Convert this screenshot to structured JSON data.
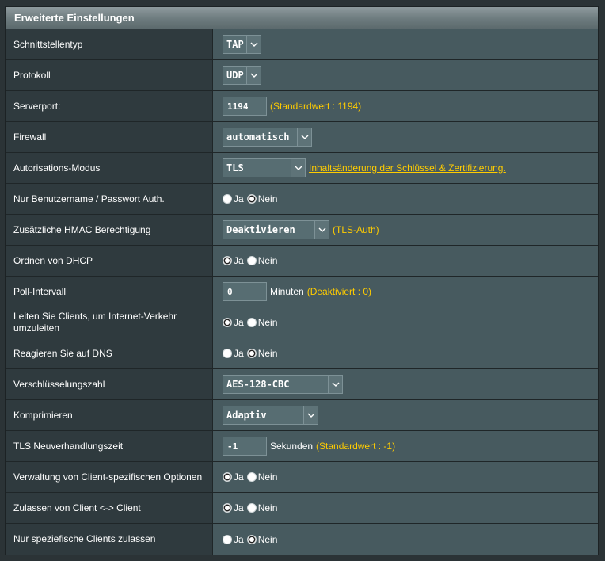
{
  "panel": {
    "title": "Erweiterte Einstellungen"
  },
  "rows": [
    {
      "label": "Schnittstellentyp",
      "select": "TAP"
    },
    {
      "label": "Protokoll",
      "select": "UDP"
    },
    {
      "label": "Serverport:",
      "input": "1194",
      "hint": "(Standardwert : 1194)"
    },
    {
      "label": "Firewall",
      "select": "automatisch"
    },
    {
      "label": "Autorisations-Modus",
      "select": "TLS",
      "link": "Inhaltsänderung der Schlüssel & Zertifizierung."
    },
    {
      "label": "Nur Benutzername / Passwort Auth.",
      "yes": "Ja",
      "no": "Nein",
      "selected": "no"
    },
    {
      "label": "Zusätzliche HMAC Berechtigung",
      "select": "Deaktivieren",
      "hint": "(TLS-Auth)"
    },
    {
      "label": "Ordnen von DHCP",
      "yes": "Ja",
      "no": "Nein",
      "selected": "yes"
    },
    {
      "label": "Poll-Intervall",
      "input": "0",
      "unit": "Minuten",
      "hint": "(Deaktiviert : 0)"
    },
    {
      "label": "Leiten Sie Clients, um Internet-Verkehr umzuleiten",
      "yes": "Ja",
      "no": "Nein",
      "selected": "yes"
    },
    {
      "label": "Reagieren Sie auf DNS",
      "yes": "Ja",
      "no": "Nein",
      "selected": "no"
    },
    {
      "label": "Verschlüsselungszahl",
      "select": "AES-128-CBC"
    },
    {
      "label": "Komprimieren",
      "select": "Adaptiv"
    },
    {
      "label": "TLS Neuverhandlungszeit",
      "input": "-1",
      "unit": "Sekunden",
      "hint": "(Standardwert : -1)"
    },
    {
      "label": "Verwaltung von Client-spezifischen Optionen",
      "yes": "Ja",
      "no": "Nein",
      "selected": "yes"
    },
    {
      "label": "Zulassen von Client <-> Client",
      "yes": "Ja",
      "no": "Nein",
      "selected": "yes"
    },
    {
      "label": "Nur speziefische Clients zulassen",
      "yes": "Ja",
      "no": "Nein",
      "selected": "no"
    }
  ]
}
